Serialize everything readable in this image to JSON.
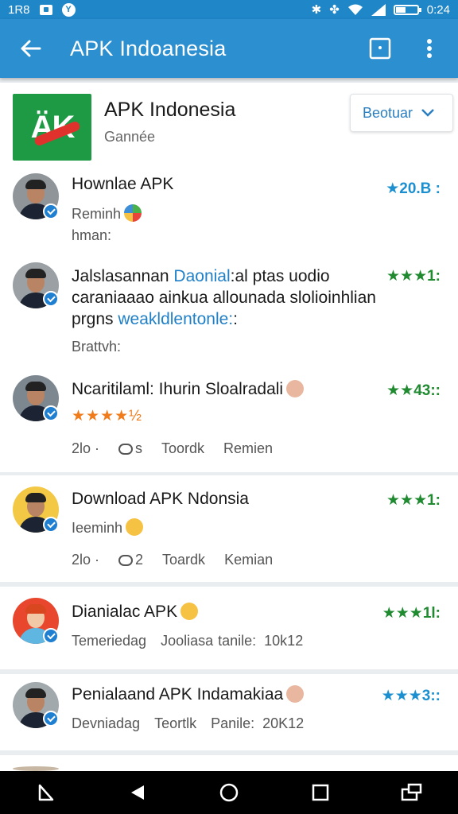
{
  "status_bar": {
    "left_text": "1R8",
    "time": "0:24"
  },
  "app_bar": {
    "title": "APK Indoanesia"
  },
  "app_header": {
    "logo_text": "ÄK",
    "name": "APK Indonesia",
    "subtitle": "Gannée",
    "filter_label": "Beotuar"
  },
  "reviews_group1": [
    {
      "title": "Hownlae APK",
      "rating": "★20.B :",
      "meta1": "Reminh",
      "meta2": "hman:"
    },
    {
      "title_a": "Jalslasannan ",
      "title_link": "Daonial",
      "title_b": ":al ptas uodio",
      "line2": "caraniaaao ainkua allounada slolioinhlian",
      "line3_a": "prgns ",
      "line3_link": "weakldlentonle:",
      "line3_b": ":",
      "meta": "Brattvh:",
      "rating": "★★★1:"
    },
    {
      "title": "Ncaritilaml: Ihurin Sloalradali",
      "stars": "★★★★½",
      "rating": "★★43::",
      "action_a": "2lo ·",
      "action_b": "s",
      "action_c": "Toordk",
      "action_d": "Remien"
    }
  ],
  "reviews_group2": [
    {
      "title": "Download APK Ndonsia",
      "meta": "Ieeminh",
      "rating": "★★★1:",
      "action_a": "2lo ·",
      "action_b": "2",
      "action_c": "Toardk",
      "action_d": "Kemian"
    },
    {
      "title": "Dianialac APK",
      "rating": "★★★1l:",
      "meta_a": "Temeriedag",
      "meta_b": "Jooliasa",
      "meta_c": "tanile:",
      "meta_d": "10k12"
    },
    {
      "title": "Penialaand APK Indamakiaa",
      "rating": "★★★3::",
      "meta_a": "Devniadag",
      "meta_b": "Teortlk",
      "meta_c": "Panile:",
      "meta_d": "20K12"
    }
  ],
  "colors": {
    "primary": "#2b8fd0",
    "status": "#1f86c8",
    "green_rating": "#1f8a2f",
    "blue_rating": "#1b8fd0",
    "orange_star": "#f07b1b",
    "link": "#1f80c8"
  },
  "icons": [
    "back-arrow-icon",
    "search-box-icon",
    "overflow-menu-icon",
    "chevron-down-icon",
    "verified-badge-icon",
    "back-triangle-icon",
    "home-circle-icon",
    "recents-square-icon"
  ]
}
